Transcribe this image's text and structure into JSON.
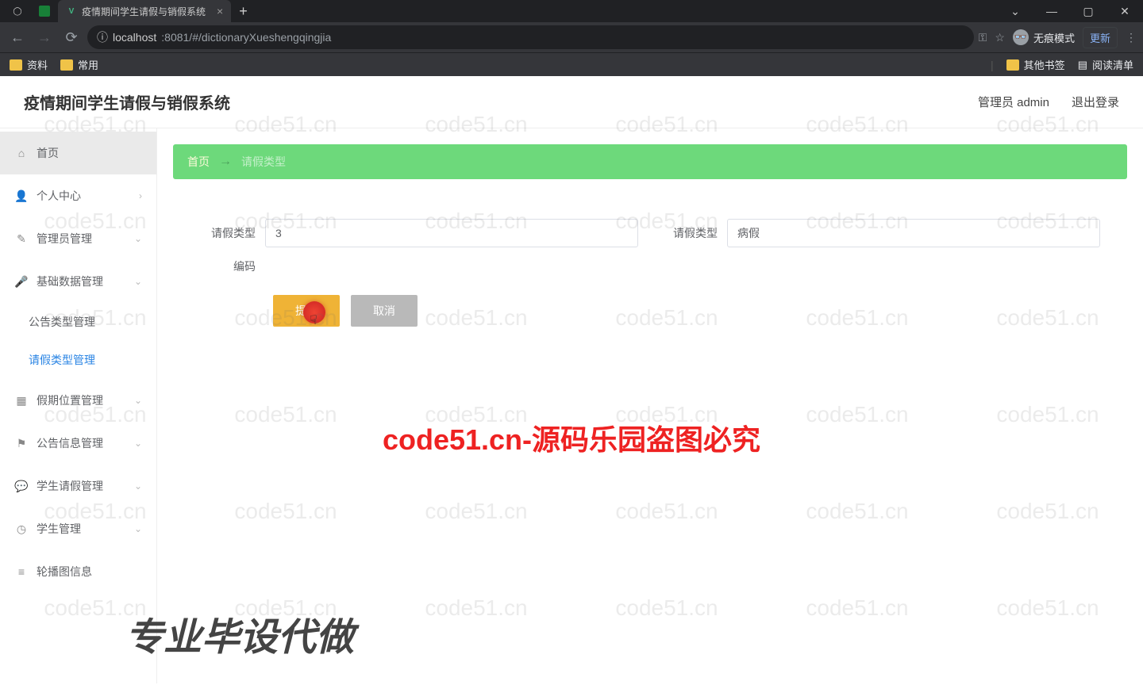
{
  "browser": {
    "tab_title": "疫情期间学生请假与销假系统",
    "url_host": "localhost",
    "url_port_path": ":8081/#/dictionaryXueshengqingjia",
    "incognito_label": "无痕模式",
    "update_label": "更新",
    "bookmarks": {
      "left": [
        "资料",
        "常用"
      ],
      "right_other": "其他书签",
      "right_reading": "阅读清单"
    }
  },
  "header": {
    "title": "疫情期间学生请假与销假系统",
    "user": "管理员 admin",
    "logout": "退出登录"
  },
  "sidebar": {
    "items": [
      {
        "label": "首页",
        "icon": "home"
      },
      {
        "label": "个人中心",
        "icon": "user"
      },
      {
        "label": "管理员管理",
        "icon": "edit"
      },
      {
        "label": "基础数据管理",
        "icon": "mic",
        "subs": [
          {
            "label": "公告类型管理"
          },
          {
            "label": "请假类型管理",
            "active": true
          }
        ]
      },
      {
        "label": "假期位置管理",
        "icon": "grid"
      },
      {
        "label": "公告信息管理",
        "icon": "flag"
      },
      {
        "label": "学生请假管理",
        "icon": "chat"
      },
      {
        "label": "学生管理",
        "icon": "clock"
      },
      {
        "label": "轮播图信息",
        "icon": "bars"
      }
    ]
  },
  "breadcrumb": {
    "home": "首页",
    "current": "请假类型"
  },
  "form": {
    "field1_label": "请假类型",
    "field1_value": "3",
    "field2_label": "请假类型",
    "field2_value": "病假",
    "field3_label": "编码",
    "submit": "提交",
    "cancel": "取消"
  },
  "watermarks": {
    "tile": "code51.cn",
    "center": "code51.cn-源码乐园盗图必究",
    "bottom": "专业毕设代做"
  }
}
